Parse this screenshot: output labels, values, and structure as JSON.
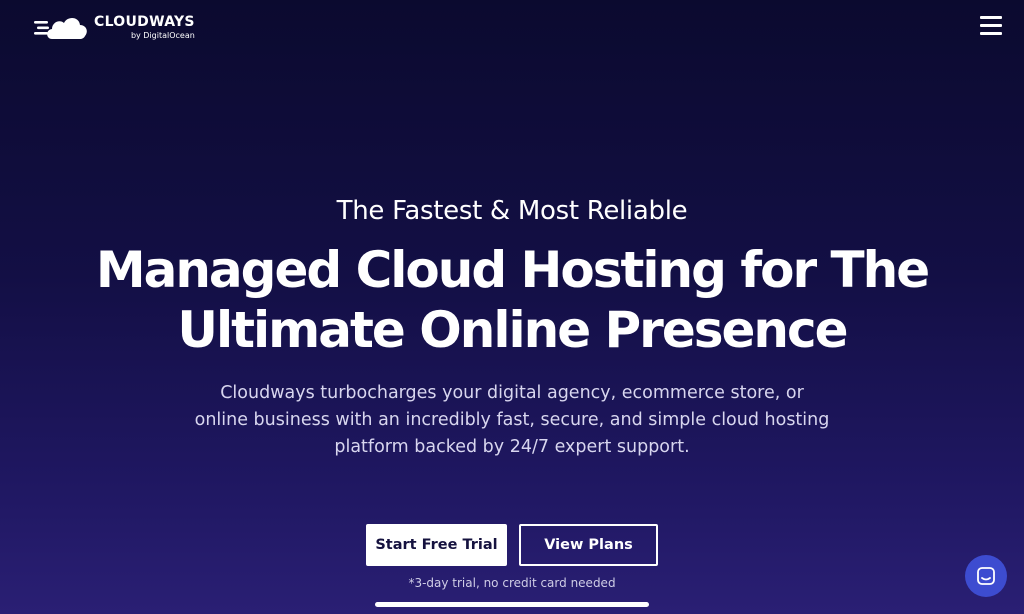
{
  "header": {
    "logo_name": "CLOUDWAYS",
    "logo_sub": "by DigitalOcean",
    "menu_icon": "hamburger-menu-icon"
  },
  "hero": {
    "eyebrow": "The Fastest & Most Reliable",
    "headline_line1": "Managed Cloud Hosting for The",
    "headline_line2": "Ultimate Online Presence",
    "description": "Cloudways turbocharges your digital agency, ecommerce store, or online business with an incredibly fast, secure, and simple cloud hosting platform backed by 24/7 expert support."
  },
  "cta": {
    "primary_label": "Start Free Trial",
    "secondary_label": "View Plans",
    "note": "*3-day trial, no credit card needed"
  },
  "chat": {
    "icon": "chat-icon",
    "color": "#3d4cd0"
  },
  "colors": {
    "background_top": "#0b0a2f",
    "background_bottom": "#2a1f74",
    "primary_button_text": "#15123f"
  }
}
